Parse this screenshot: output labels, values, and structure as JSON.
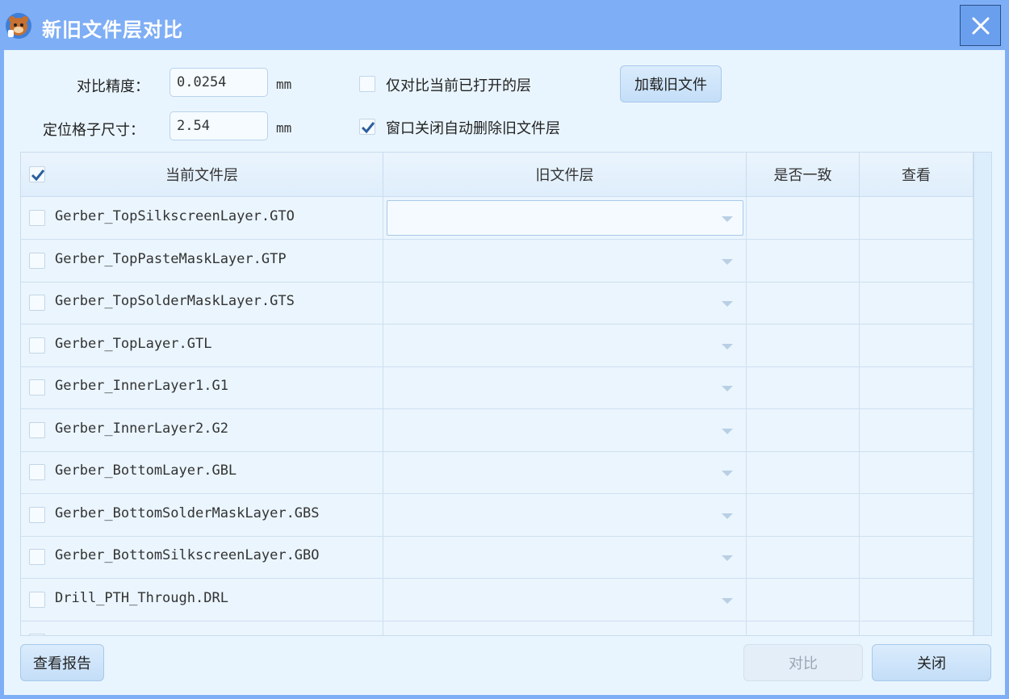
{
  "window": {
    "title": "新旧文件层对比",
    "close_icon": "close-icon"
  },
  "settings": {
    "precision_label": "对比精度：",
    "precision_value": "0.0254",
    "precision_unit": "mm",
    "grid_label": "定位格子尺寸：",
    "grid_value": "2.54",
    "grid_unit": "mm",
    "only_open_label": "仅对比当前已打开的层",
    "only_open_checked": false,
    "auto_delete_label": "窗口关闭自动删除旧文件层",
    "auto_delete_checked": true,
    "load_old_button": "加载旧文件"
  },
  "table": {
    "headers": {
      "current": "当前文件层",
      "old": "旧文件层",
      "match": "是否一致",
      "view": "查看"
    },
    "select_all_checked": true,
    "rows": [
      {
        "name": "Gerber_TopSilkscreenLayer.GTO",
        "old": "",
        "match": "",
        "checked": false
      },
      {
        "name": "Gerber_TopPasteMaskLayer.GTP",
        "old": "",
        "match": "",
        "checked": false
      },
      {
        "name": "Gerber_TopSolderMaskLayer.GTS",
        "old": "",
        "match": "",
        "checked": false
      },
      {
        "name": "Gerber_TopLayer.GTL",
        "old": "",
        "match": "",
        "checked": false
      },
      {
        "name": "Gerber_InnerLayer1.G1",
        "old": "",
        "match": "",
        "checked": false
      },
      {
        "name": "Gerber_InnerLayer2.G2",
        "old": "",
        "match": "",
        "checked": false
      },
      {
        "name": "Gerber_BottomLayer.GBL",
        "old": "",
        "match": "",
        "checked": false
      },
      {
        "name": "Gerber_BottomSolderMaskLayer.GBS",
        "old": "",
        "match": "",
        "checked": false
      },
      {
        "name": "Gerber_BottomSilkscreenLayer.GBO",
        "old": "",
        "match": "",
        "checked": false
      },
      {
        "name": "Drill_PTH_Through.DRL",
        "old": "",
        "match": "",
        "checked": false
      },
      {
        "name": "",
        "old": "",
        "match": "",
        "checked": false
      }
    ]
  },
  "footer": {
    "report_button": "查看报告",
    "compare_button": "对比",
    "close_button": "关闭"
  }
}
